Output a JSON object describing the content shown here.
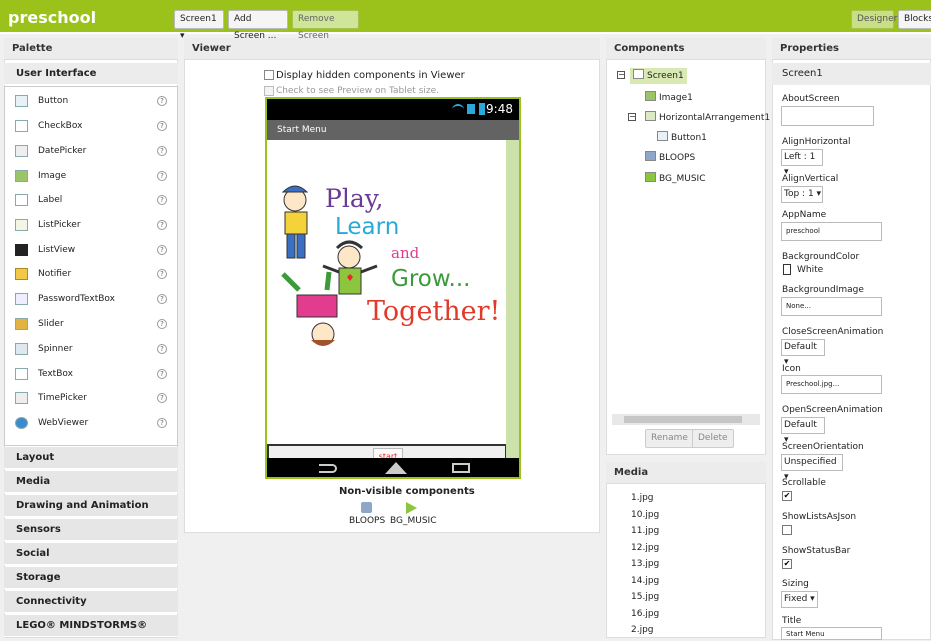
{
  "topbar": {
    "project_title": "preschool",
    "screen_selector": "Screen1 ▾",
    "add_screen": "Add Screen ...",
    "remove_screen": "Remove Screen",
    "designer": "Designer",
    "blocks": "Blocks"
  },
  "palette": {
    "title": "Palette",
    "open_category": "User Interface",
    "items": [
      "Button",
      "CheckBox",
      "DatePicker",
      "Image",
      "Label",
      "ListPicker",
      "ListView",
      "Notifier",
      "PasswordTextBox",
      "Slider",
      "Spinner",
      "TextBox",
      "TimePicker",
      "WebViewer"
    ],
    "help_glyph": "?",
    "categories": [
      "Layout",
      "Media",
      "Drawing and Animation",
      "Sensors",
      "Social",
      "Storage",
      "Connectivity",
      "LEGO® MINDSTORMS®"
    ]
  },
  "viewer": {
    "title": "Viewer",
    "display_hidden": "Display hidden components in Viewer",
    "tablet_preview": "Check to see Preview on Tablet size.",
    "clock": "9:48",
    "screen_title": "Start Menu",
    "start_button": "start",
    "nonvisible_title": "Non-visible components",
    "nonvisible": [
      "BLOOPS",
      "BG_MUSIC"
    ],
    "logo_words": [
      "Play,",
      "Learn",
      "and",
      "Grow...",
      "Together!"
    ]
  },
  "components": {
    "title": "Components",
    "tree": [
      "Screen1",
      "Image1",
      "HorizontalArrangement1",
      "Button1",
      "BLOOPS",
      "BG_MUSIC"
    ],
    "rename": "Rename",
    "delete": "Delete"
  },
  "media": {
    "title": "Media",
    "files": [
      "1.jpg",
      "10.jpg",
      "11.jpg",
      "12.jpg",
      "13.jpg",
      "14.jpg",
      "15.jpg",
      "16.jpg",
      "2.jpg"
    ]
  },
  "properties": {
    "title": "Properties",
    "component": "Screen1",
    "about_screen": "AboutScreen",
    "align_horizontal": "AlignHorizontal",
    "align_horizontal_value": "Left : 1 ▾",
    "align_vertical": "AlignVertical",
    "align_vertical_value": "Top : 1 ▾",
    "app_name": "AppName",
    "app_name_value": "preschool",
    "background_color": "BackgroundColor",
    "background_color_value": "White",
    "background_image": "BackgroundImage",
    "background_image_value": "None...",
    "close_screen_animation": "CloseScreenAnimation",
    "close_screen_animation_value": "Default ▾",
    "icon": "Icon",
    "icon_value": "Preschool.jpg...",
    "open_screen_animation": "OpenScreenAnimation",
    "open_screen_animation_value": "Default ▾",
    "screen_orientation": "ScreenOrientation",
    "screen_orientation_value": "Unspecified ▾",
    "scrollable": "Scrollable",
    "show_lists_as_json": "ShowListsAsJson",
    "show_status_bar": "ShowStatusBar",
    "sizing": "Sizing",
    "sizing_value": "Fixed ▾",
    "title_label": "Title",
    "title_value": "Start Menu",
    "checkmark": "✔"
  },
  "colors": {
    "accent": "#9ac21a",
    "panel_header": "#ececec",
    "selected_tree": "#d9e9b3"
  }
}
